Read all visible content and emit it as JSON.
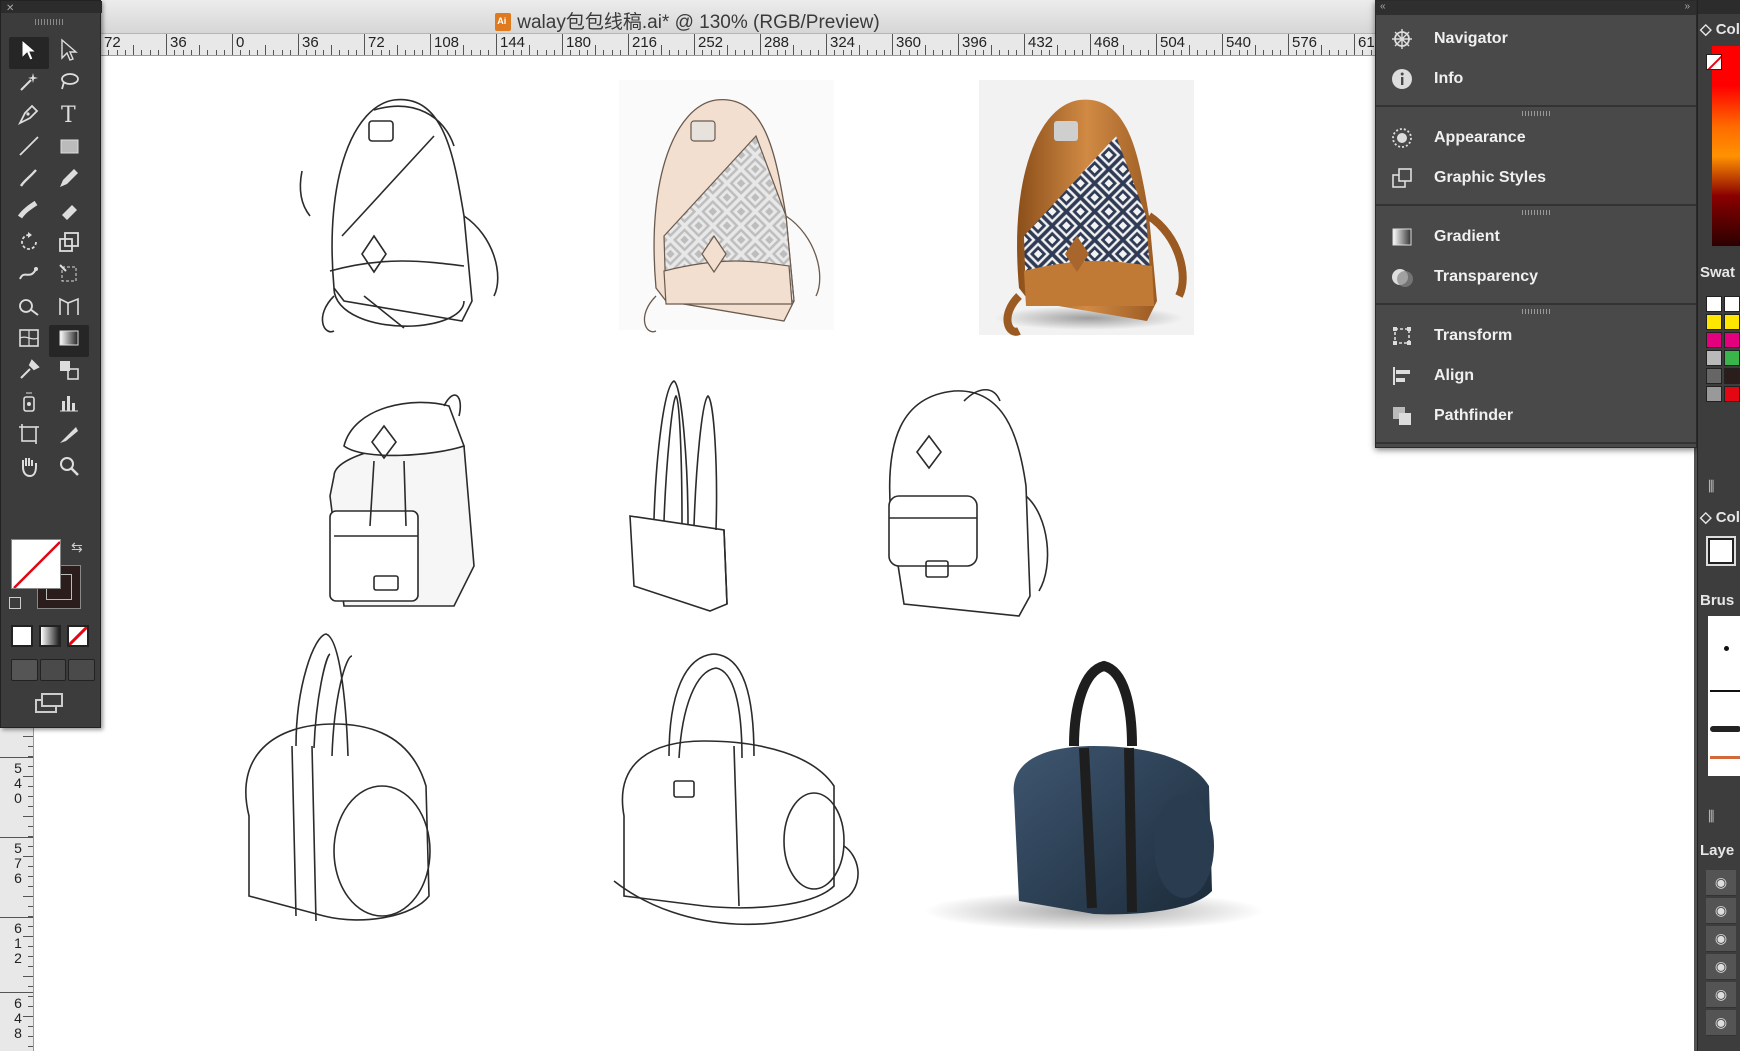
{
  "window": {
    "title": "walay包包线稿.ai* @ 130% (RGB/Preview)"
  },
  "ruler_h": {
    "labels": [
      "72",
      "36",
      "0",
      "36",
      "72",
      "108",
      "144",
      "180",
      "216",
      "252",
      "288",
      "324",
      "360",
      "396",
      "432",
      "468",
      "504",
      "540",
      "576",
      "61"
    ]
  },
  "ruler_v": {
    "labels": [
      "504",
      "540",
      "576",
      "612",
      "648"
    ]
  },
  "tools": [
    {
      "name": "selection-tool",
      "icon": "arrow-icon"
    },
    {
      "name": "direct-selection-tool",
      "icon": "white-arrow-icon"
    },
    {
      "name": "magic-wand-tool",
      "icon": "magic-wand-icon"
    },
    {
      "name": "lasso-tool",
      "icon": "lasso-icon"
    },
    {
      "name": "pen-tool",
      "icon": "pen-icon"
    },
    {
      "name": "type-tool",
      "icon": "type-icon"
    },
    {
      "name": "line-tool",
      "icon": "line-icon"
    },
    {
      "name": "rectangle-tool",
      "icon": "rectangle-icon"
    },
    {
      "name": "paintbrush-tool",
      "icon": "brush-icon"
    },
    {
      "name": "pencil-tool",
      "icon": "pencil-icon"
    },
    {
      "name": "blob-brush-tool",
      "icon": "blob-brush-icon"
    },
    {
      "name": "eraser-tool",
      "icon": "eraser-icon"
    },
    {
      "name": "rotate-tool",
      "icon": "rotate-icon"
    },
    {
      "name": "scale-tool",
      "icon": "scale-icon"
    },
    {
      "name": "warp-tool",
      "icon": "warp-icon"
    },
    {
      "name": "free-transform-tool",
      "icon": "free-transform-icon"
    },
    {
      "name": "shape-builder-tool",
      "icon": "shape-builder-icon"
    },
    {
      "name": "perspective-grid-tool",
      "icon": "perspective-grid-icon"
    },
    {
      "name": "mesh-tool",
      "icon": "mesh-icon"
    },
    {
      "name": "gradient-tool",
      "icon": "gradient-icon"
    },
    {
      "name": "eyedropper-tool",
      "icon": "eyedropper-icon"
    },
    {
      "name": "blend-tool",
      "icon": "blend-icon"
    },
    {
      "name": "symbol-sprayer-tool",
      "icon": "symbol-sprayer-icon"
    },
    {
      "name": "column-graph-tool",
      "icon": "graph-icon"
    },
    {
      "name": "artboard-tool",
      "icon": "artboard-icon"
    },
    {
      "name": "slice-tool",
      "icon": "slice-icon"
    },
    {
      "name": "hand-tool",
      "icon": "hand-icon"
    },
    {
      "name": "zoom-tool",
      "icon": "zoom-icon"
    }
  ],
  "panel_groups": [
    {
      "items": [
        {
          "label": "Navigator",
          "icon": "navigator-icon"
        },
        {
          "label": "Info",
          "icon": "info-icon"
        }
      ]
    },
    {
      "items": [
        {
          "label": "Appearance",
          "icon": "appearance-icon"
        },
        {
          "label": "Graphic Styles",
          "icon": "graphic-styles-icon"
        }
      ]
    },
    {
      "items": [
        {
          "label": "Gradient",
          "icon": "gradient-icon"
        },
        {
          "label": "Transparency",
          "icon": "transparency-icon"
        }
      ]
    },
    {
      "items": [
        {
          "label": "Transform",
          "icon": "transform-icon"
        },
        {
          "label": "Align",
          "icon": "align-icon"
        },
        {
          "label": "Pathfinder",
          "icon": "pathfinder-icon"
        }
      ]
    }
  ],
  "dock": {
    "color_label": "Col",
    "swatches_label": "Swat",
    "color_guide_label": "Col",
    "brushes_label": "Brus",
    "layers_label": "Laye",
    "swatch_colors": [
      "#ffffff",
      "#ffffff",
      "#ffe600",
      "#ffe600",
      "#e3007f",
      "#e3007f",
      "#b9b9b9",
      "#39b54a",
      "#666666",
      "#2b1d1b",
      "#999999",
      "#e30613"
    ]
  },
  "colors": {
    "fill": "#ffffff",
    "stroke": "#2b1d1b",
    "canvas": "#ffffff",
    "leather": "#c8843f",
    "pattern_navy": "#2f3a55",
    "duffel_blue": "#2d4258"
  }
}
